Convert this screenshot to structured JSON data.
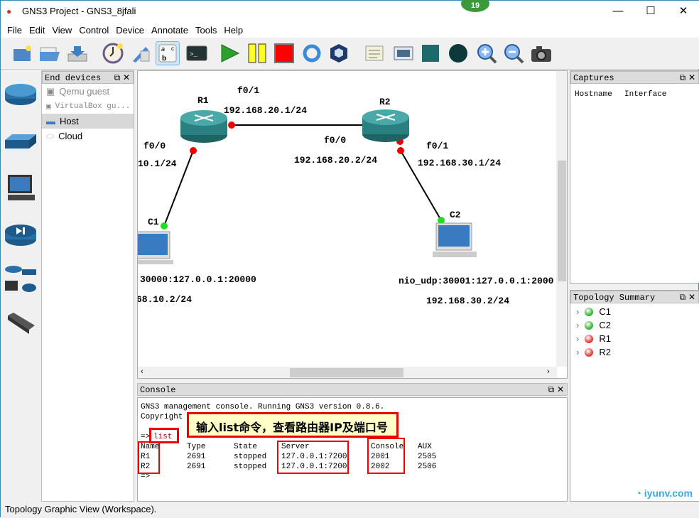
{
  "window": {
    "title": "GNS3 Project - GNS3_8jfali",
    "badge": "19"
  },
  "menu": [
    "File",
    "Edit",
    "View",
    "Control",
    "Device",
    "Annotate",
    "Tools",
    "Help"
  ],
  "toolbar": [
    "new-project",
    "open-project",
    "save-project",
    "snapshot",
    "import-export",
    "show-interface-labels",
    "console-all",
    "start-all",
    "suspend-all",
    "stop-all",
    "reload-all",
    "virtualbox",
    "add-note",
    "insert-picture",
    "draw-rectangle",
    "draw-ellipse",
    "zoom-in",
    "zoom-out",
    "screenshot"
  ],
  "end_devices": {
    "title": "End devices",
    "items": [
      "Qemu guest",
      "VirtualBox gu...",
      "Host",
      "Cloud"
    ]
  },
  "topology": {
    "nodes": {
      "r1": "R1",
      "r2": "R2",
      "c1": "C1",
      "c2": "C2"
    },
    "labels": {
      "r1_f01": "f0/1",
      "r1_ip1": "192.168.20.1/24",
      "r1_f00": "f0/0",
      "r1_ip0": "10.1/24",
      "r2_f00": "f0/0",
      "r2_ip0": "192.168.20.2/24",
      "r2_f01": "f0/1",
      "r2_ip1": "192.168.30.1/24",
      "c1_nio": "30000:127.0.0.1:20000",
      "c1_ip": "68.10.2/24",
      "c2_nio": "nio_udp:30001:127.0.0.1:2000",
      "c2_ip": "192.168.30.2/24"
    }
  },
  "console": {
    "title": "Console",
    "line1": "GNS3 management console. Running GNS3 version 0.8.6.",
    "line2": "Copyright",
    "prompt": "=>",
    "command": "list",
    "callout": "输入list命令，查看路由器IP及端口号",
    "headers": [
      "Name",
      "Type",
      "State",
      "Server",
      "Console",
      "AUX"
    ],
    "rows": [
      [
        "R1",
        "2691",
        "stopped",
        "127.0.0.1:7200",
        "2001",
        "2505"
      ],
      [
        "R2",
        "2691",
        "stopped",
        "127.0.0.1:7200",
        "2002",
        "2506"
      ]
    ],
    "end_prompt": "=>"
  },
  "captures": {
    "title": "Captures",
    "headers": [
      "Hostname",
      "Interface"
    ]
  },
  "topology_summary": {
    "title": "Topology Summary",
    "items": [
      {
        "name": "C1",
        "color": "#3cb43c"
      },
      {
        "name": "C2",
        "color": "#3cb43c"
      },
      {
        "name": "R1",
        "color": "#e04040"
      },
      {
        "name": "R2",
        "color": "#e04040"
      }
    ]
  },
  "status": "Topology Graphic View (Workspace).",
  "watermark": "运维网 iyunv.com"
}
